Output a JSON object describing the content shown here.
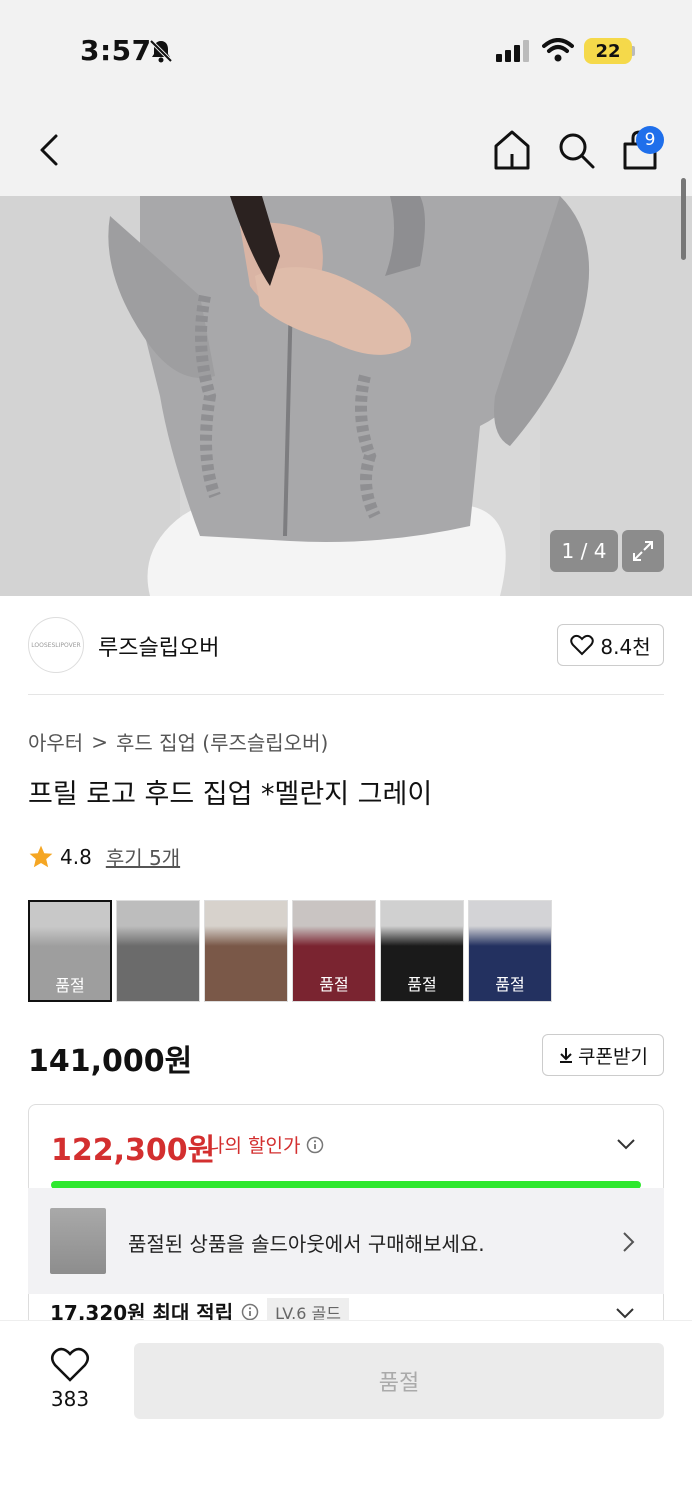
{
  "status_bar": {
    "time": "3:57",
    "battery": "22"
  },
  "nav": {
    "cart_badge": "9"
  },
  "gallery": {
    "counter": "1 / 4"
  },
  "brand": {
    "logo_text": "LOOSESLIPOVER",
    "name": "루즈슬립오버",
    "likes": "8.4천"
  },
  "breadcrumb": {
    "category": "아우터",
    "separator": ">",
    "subcategory": "후드 집업 (루즈슬립오버)"
  },
  "product": {
    "title": "프릴 로고 후드 집업 *멜란지 그레이",
    "rating": "4.8",
    "reviews": "후기 5개",
    "price": "141,000원",
    "coupon_label": "쿠폰받기"
  },
  "swatches": [
    {
      "label": "품절",
      "colors": [
        "#c8c8c8",
        "#9e9e9e"
      ]
    },
    {
      "label": "",
      "colors": [
        "#bdbdbd",
        "#6b6b6b"
      ]
    },
    {
      "label": "",
      "colors": [
        "#d7d2cc",
        "#7a5848"
      ]
    },
    {
      "label": "품절",
      "colors": [
        "#c9c4c2",
        "#7a2430"
      ]
    },
    {
      "label": "품절",
      "colors": [
        "#d0d0d0",
        "#1a1a1a"
      ]
    },
    {
      "label": "품절",
      "colors": [
        "#d3d3d6",
        "#233160"
      ]
    }
  ],
  "discount": {
    "price": "122,300원",
    "label": "나의 할인가",
    "banner_text": "품절된 상품을 솔드아웃에서 구매해보세요.",
    "points": "17,320원 최대 적립",
    "level": "LV.6 골드"
  },
  "bottom": {
    "wish_count": "383",
    "buy_label": "품절"
  },
  "colors": {
    "accent_red": "#d32f2f",
    "badge_blue": "#1f6feb",
    "progress_green": "#2ee82e"
  }
}
